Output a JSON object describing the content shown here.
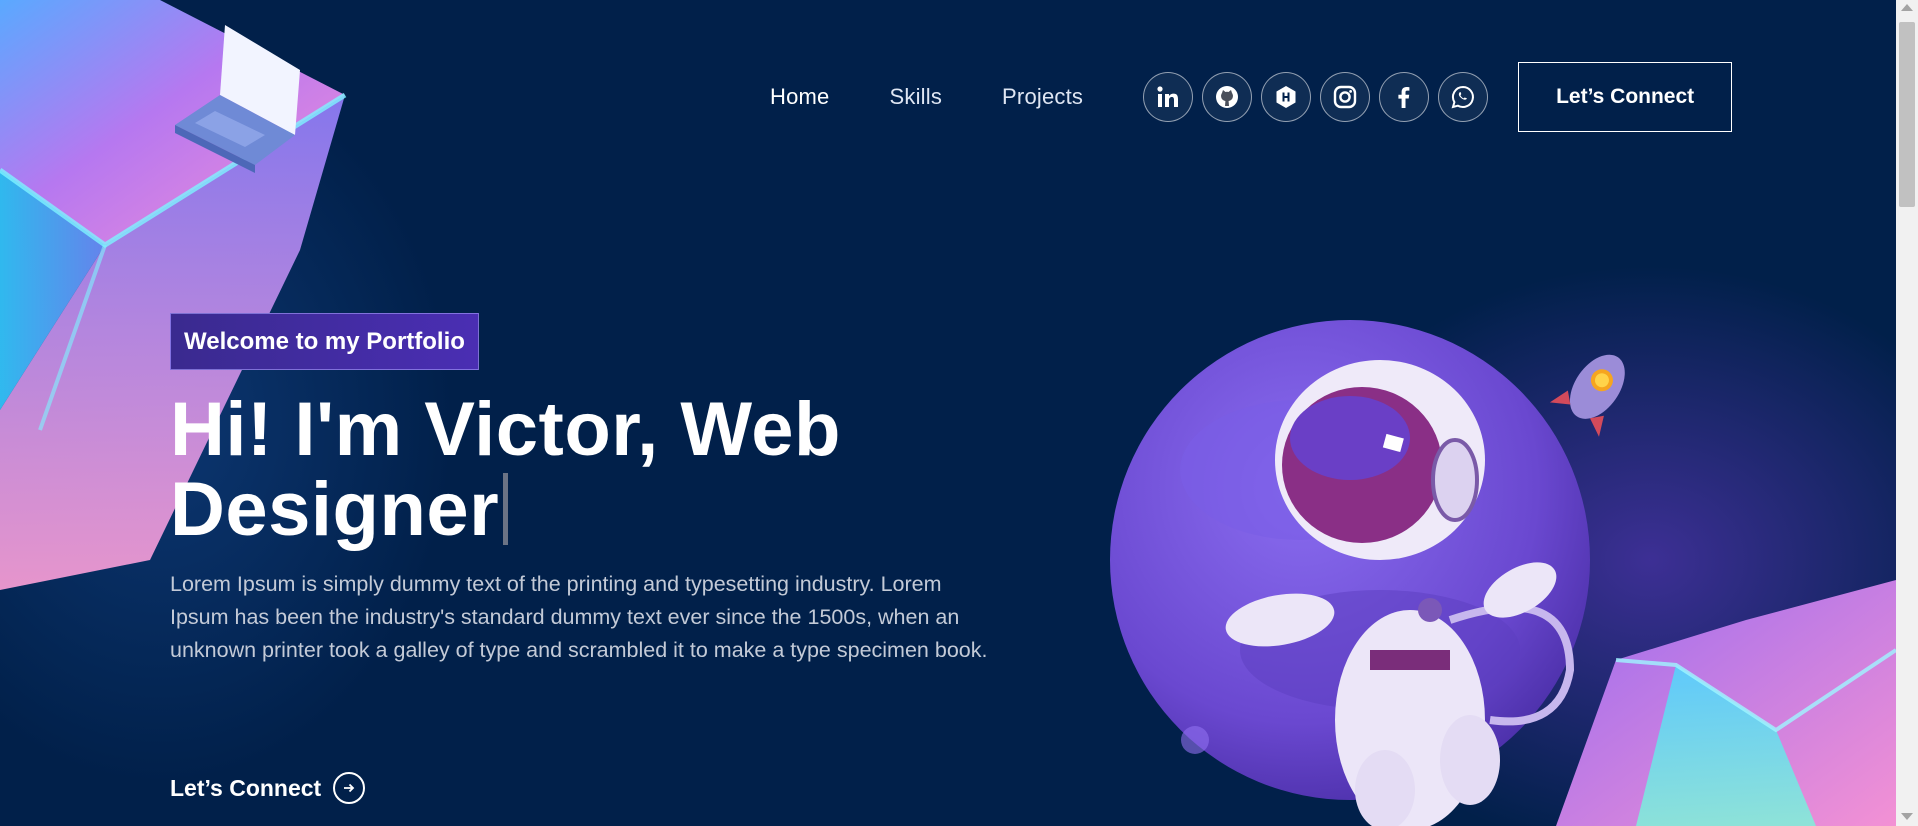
{
  "nav": {
    "links": [
      {
        "label": "Home"
      },
      {
        "label": "Skills"
      },
      {
        "label": "Projects"
      }
    ],
    "socials": [
      {
        "icon": "linkedin-icon"
      },
      {
        "icon": "github-icon"
      },
      {
        "icon": "hackerrank-icon"
      },
      {
        "icon": "instagram-icon"
      },
      {
        "icon": "facebook-icon"
      },
      {
        "icon": "whatsapp-icon"
      }
    ],
    "connect_label": "Let’s Connect"
  },
  "hero": {
    "tagline": "Welcome to my Portfolio",
    "headline": "Hi! I'm Victor, Web Designer",
    "description": "Lorem Ipsum is simply dummy text of the printing and typesetting industry. Lorem Ipsum has been the industry's standard dummy text ever since the 1500s, when an unknown printer took a galley of type and scrambled it to make a type specimen book.",
    "cta_label": "Let’s Connect"
  },
  "colors": {
    "background": "#01204a",
    "tagline_bg": "#4a2eb3",
    "planet": "#6b4fd8"
  }
}
